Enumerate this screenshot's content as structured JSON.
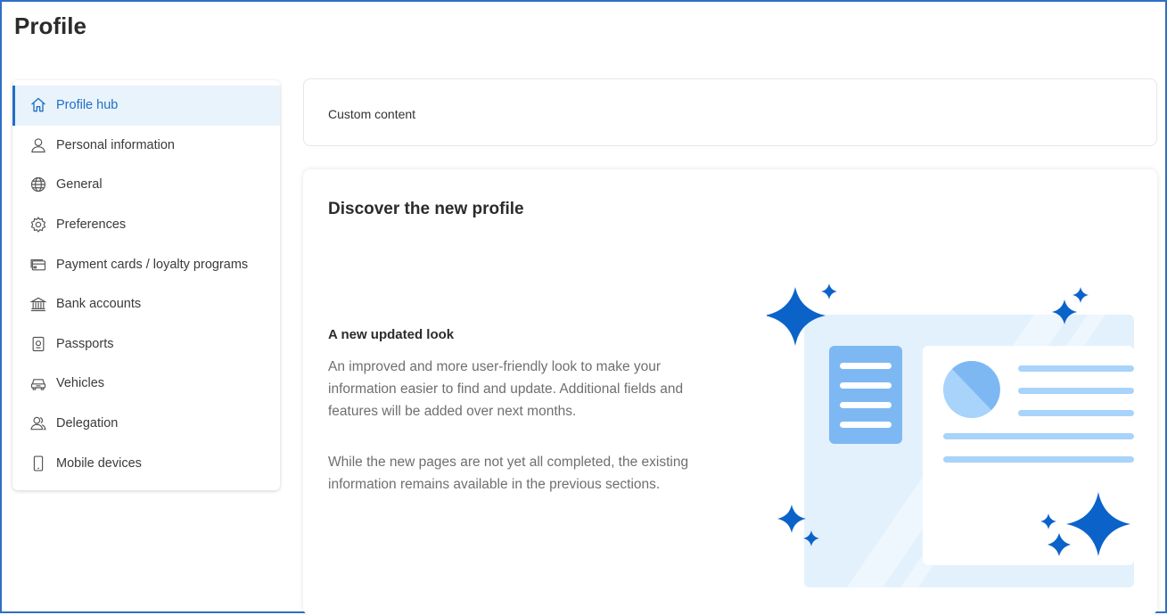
{
  "header": {
    "title": "Profile"
  },
  "sidebar": {
    "items": [
      {
        "label": "Profile hub",
        "icon": "home-icon",
        "active": true
      },
      {
        "label": "Personal information",
        "icon": "person-icon"
      },
      {
        "label": "General",
        "icon": "globe-icon"
      },
      {
        "label": "Preferences",
        "icon": "gear-icon"
      },
      {
        "label": "Payment cards / loyalty programs",
        "icon": "card-icon"
      },
      {
        "label": "Bank accounts",
        "icon": "bank-icon"
      },
      {
        "label": "Passports",
        "icon": "passport-icon"
      },
      {
        "label": "Vehicles",
        "icon": "car-icon"
      },
      {
        "label": "Delegation",
        "icon": "people-icon"
      },
      {
        "label": "Mobile devices",
        "icon": "mobile-icon"
      }
    ]
  },
  "main": {
    "custom_content": "Custom content",
    "discover": {
      "title": "Discover the new profile",
      "subtitle": "A new updated look",
      "paragraph1": "An improved and more user-friendly look to make your information easier to find and update. Additional fields and features will be added over next months.",
      "paragraph2": "While the new pages are not yet all completed, the existing information remains available in the previous sections."
    }
  },
  "colors": {
    "accent": "#1f6fc5",
    "active_bg": "#e9f3fc",
    "frame_border": "#2f6fc4",
    "illustration_light": "#e3f1fd",
    "illustration_mid": "#7db8f3",
    "illustration_dark": "#0b63c9"
  }
}
